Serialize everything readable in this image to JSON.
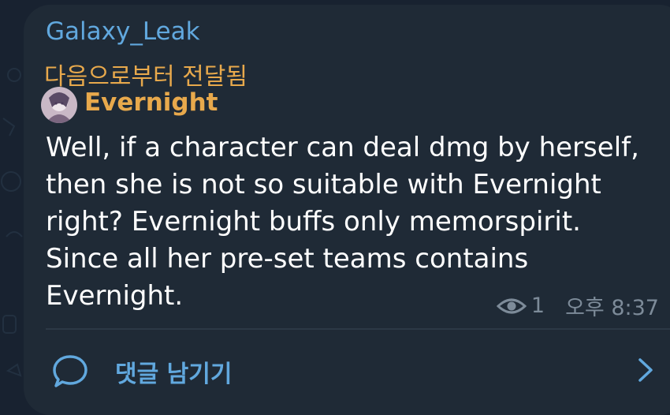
{
  "channel": {
    "sender_name": "Galaxy_Leak"
  },
  "forward": {
    "label": "다음으로부터 전달됨",
    "source_name": "Evernight"
  },
  "message": {
    "lines": [
      "Well, if a character can deal dmg by herself,",
      "then she is not so suitable with Evernight",
      "right? Evernight buffs only memorspirit.",
      "Since all her pre-set teams contains",
      "Evernight."
    ],
    "views": "1",
    "time": "오후 8:37"
  },
  "comments": {
    "label": "댓글 남기기"
  },
  "colors": {
    "background": "#182230",
    "bubble": "#1f2a36",
    "link_blue": "#61a8de",
    "forward_orange": "#e8a94c",
    "meta_gray": "#7d8b99"
  },
  "icons": {
    "views": "eye-icon",
    "comments": "comment-bubble-icon",
    "open": "chevron-right-icon"
  }
}
